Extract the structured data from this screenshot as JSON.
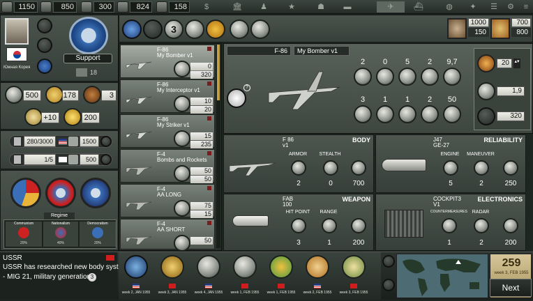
{
  "resources": [
    {
      "icon": "money-icon",
      "value": "1150"
    },
    {
      "icon": "factory-icon",
      "value": "850"
    },
    {
      "icon": "research-icon",
      "value": "300"
    },
    {
      "icon": "industry-icon",
      "value": "824"
    },
    {
      "icon": "trophy-icon",
      "value": "158"
    }
  ],
  "leader": {
    "country": "Южная Корея",
    "support_label": "Support",
    "support_count": "18"
  },
  "left_stats": {
    "a": "500",
    "b": "178",
    "c": "3",
    "d": "+10",
    "e": "200"
  },
  "production": [
    {
      "value": "280/3000",
      "count": "1500"
    },
    {
      "value": "1/5",
      "count": "500"
    }
  ],
  "regime": {
    "title": "Regime",
    "options": [
      {
        "label": "Communism",
        "pct": "20%"
      },
      {
        "label": "Nationalism",
        "pct": "40%"
      },
      {
        "label": "Democratism",
        "pct": "20%"
      }
    ]
  },
  "right_top": {
    "a1": "1000",
    "a2": "150",
    "b1": "700",
    "b2": "800"
  },
  "list_items": [
    {
      "type": "F-86",
      "name": "My Bomber v1",
      "v1": "0",
      "v2": "320"
    },
    {
      "type": "F-86",
      "name": "My Interceptor v1",
      "v1": "10",
      "v2": "20"
    },
    {
      "type": "F-86",
      "name": "My Striker v1",
      "v1": "15",
      "v2": "235"
    },
    {
      "type": "F-4",
      "name": "Bombs and Rockets",
      "v1": "50",
      "v2": "50"
    },
    {
      "type": "F-4",
      "name": "AA LONG",
      "v1": "75",
      "v2": "15"
    },
    {
      "type": "F-4",
      "name": "AA SHORT",
      "v1": "50",
      "v2": ""
    }
  ],
  "design": {
    "model": "F-86",
    "name": "My Bomber v1",
    "tier": "3",
    "top_stats": [
      "2",
      "0",
      "5",
      "2",
      "9,7"
    ],
    "bottom_stats": [
      "3",
      "1",
      "1",
      "2",
      "50"
    ],
    "side": {
      "v1": "20",
      "v2": "1,9",
      "v3": "320"
    }
  },
  "sections": {
    "body": {
      "category": "BODY",
      "name": "F 86",
      "sub": "v1",
      "labels": [
        "ARMOR",
        "STEALTH"
      ],
      "values": [
        "2",
        "0",
        "700"
      ]
    },
    "reliability": {
      "category": "RELIABILITY",
      "name": "J47",
      "sub": "GE-27",
      "labels": [
        "ENGINE",
        "MANEUVER"
      ],
      "values": [
        "5",
        "2",
        "250"
      ]
    },
    "weapon": {
      "category": "WEAPON",
      "name": "FAB",
      "sub": "100",
      "labels": [
        "HIT POINT",
        "RANGE"
      ],
      "values": [
        "3",
        "1",
        "200"
      ]
    },
    "electronics": {
      "category": "ELECTRONICS",
      "name": "COCKPIT3",
      "sub": "V1",
      "labels": [
        "COUNTERMEASURES",
        "RADAR"
      ],
      "values": [
        "1",
        "2",
        "200"
      ]
    }
  },
  "news": {
    "country": "USSR",
    "line1": "USSR has researched new body system",
    "line2": "- MIG 21, military generation",
    "badge": "3"
  },
  "timeline": [
    {
      "flag": "us",
      "date": "week 2, JAN 1955"
    },
    {
      "flag": "su",
      "date": "week 3, JAN 1955"
    },
    {
      "flag": "us",
      "date": "week 4, JAN 1955"
    },
    {
      "flag": "su",
      "date": "week 1, FEB 1955"
    },
    {
      "flag": "su",
      "date": "week 1, FEB 1955"
    },
    {
      "flag": "us",
      "date": "week 2, FEB 1955"
    },
    {
      "flag": "su",
      "date": "week 3, FEB 1955"
    }
  ],
  "turn": {
    "number": "259",
    "date": "week 3, FEB 1955",
    "next_label": "Next"
  }
}
